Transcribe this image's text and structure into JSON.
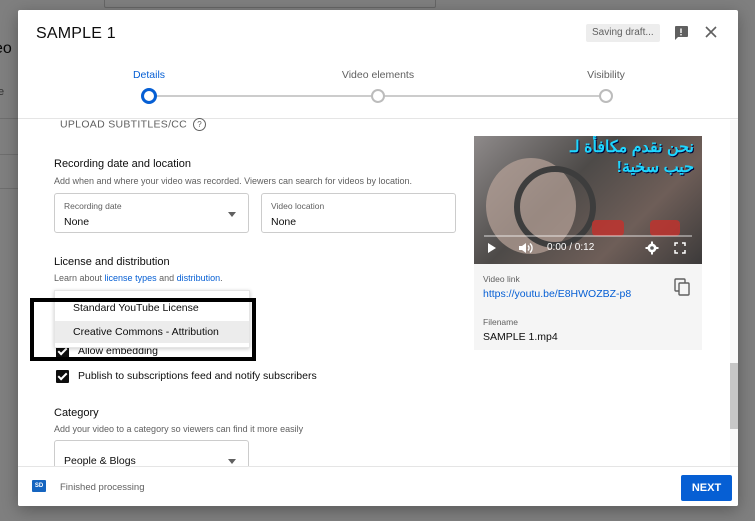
{
  "background": {
    "left_text_1": "eo",
    "left_text_2": "e"
  },
  "dialog": {
    "title": "SAMPLE 1",
    "saving_status": "Saving draft...",
    "stepper": {
      "steps": [
        {
          "label": "Details",
          "active": true
        },
        {
          "label": "Video elements",
          "active": false
        },
        {
          "label": "Visibility",
          "active": false
        }
      ]
    },
    "upload_subtitles": "UPLOAD SUBTITLES/CC",
    "help_glyph": "?",
    "recording": {
      "title": "Recording date and location",
      "description": "Add when and where your video was recorded. Viewers can search for videos by location.",
      "date_label": "Recording date",
      "date_value": "None",
      "location_label": "Video location",
      "location_value": "None"
    },
    "license": {
      "title": "License and distribution",
      "desc_prefix": "Learn about ",
      "desc_link1": "license types",
      "desc_mid": " and ",
      "desc_link2": "distribution",
      "desc_suffix": ".",
      "options": [
        "Standard YouTube License",
        "Creative Commons - Attribution"
      ],
      "hovered_option": "Creative Commons - Attribution"
    },
    "allow_embedding": "Allow embedding",
    "publish_feed": "Publish to subscriptions feed and notify subscribers",
    "category": {
      "title": "Category",
      "description": "Add your video to a category so viewers can find it more easily",
      "value": "People & Blogs"
    },
    "video": {
      "arabic_line1": "نحن نقدم مكافأة لـ",
      "arabic_line2": "حيب سخية!",
      "time": "0:00 / 0:12",
      "progress_fraction": 0.0,
      "link_label": "Video link",
      "link": "https://youtu.be/E8HWOZBZ-p8",
      "filename_label": "Filename",
      "filename": "SAMPLE 1.mp4"
    },
    "footer": {
      "sd_badge": "SD",
      "status": "Finished processing",
      "next_label": "NEXT"
    }
  },
  "colors": {
    "accent": "#065fd4",
    "text": "#0d0d0d",
    "secondary_text": "#606060"
  }
}
